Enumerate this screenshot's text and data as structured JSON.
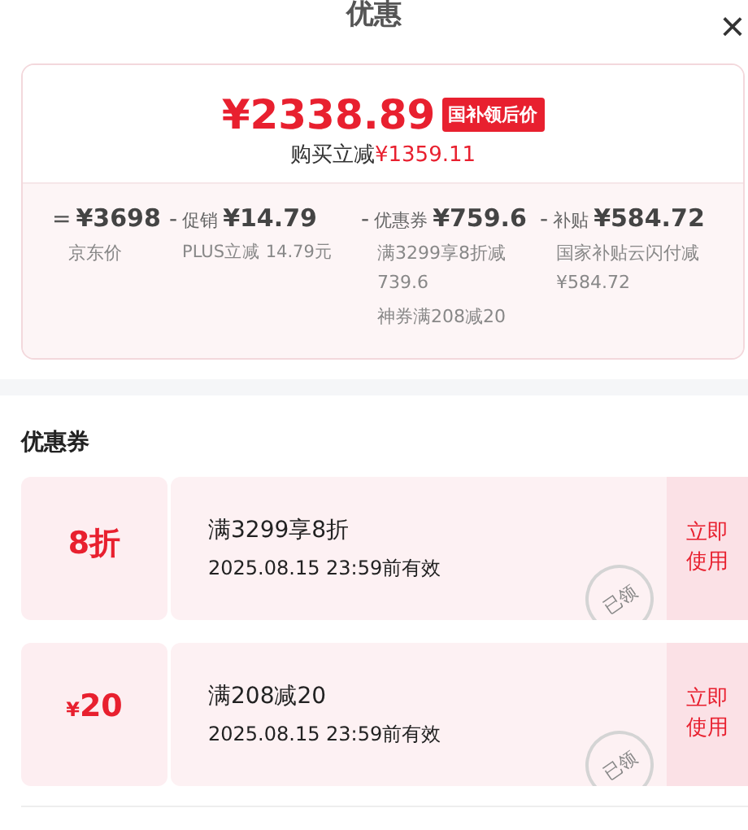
{
  "header": {
    "title": "优惠",
    "close": "×"
  },
  "summary": {
    "price": "¥2338.89",
    "price_tag": "国补领后价",
    "saving_label": "购买立减",
    "saving": "¥1359.11",
    "breakdown": [
      {
        "op": "=",
        "value": "¥3698",
        "notes": [
          "京东价"
        ]
      },
      {
        "op": "-",
        "label": "促销",
        "value": "¥14.79",
        "notes": [
          "PLUS立减 14.79元"
        ]
      },
      {
        "op": "-",
        "label": "优惠券",
        "value": "¥759.6",
        "notes": [
          "满3299享8折减739.6",
          "神券满208减20"
        ]
      },
      {
        "op": "-",
        "label": "补贴",
        "value": "¥584.72",
        "notes": [
          "国家补贴云闪付减¥584.72"
        ]
      }
    ]
  },
  "coupons_section": {
    "title": "优惠券",
    "coupons": [
      {
        "amount": "8折",
        "condition": "满3299享8折",
        "expiry": "2025.08.15 23:59前有效",
        "stamp": "已领",
        "action": "立即使用"
      },
      {
        "symbol": "¥",
        "amount": "20",
        "condition": "满208减20",
        "expiry": "2025.08.15 23:59前有效",
        "stamp": "已领",
        "action": "立即使用"
      }
    ]
  }
}
